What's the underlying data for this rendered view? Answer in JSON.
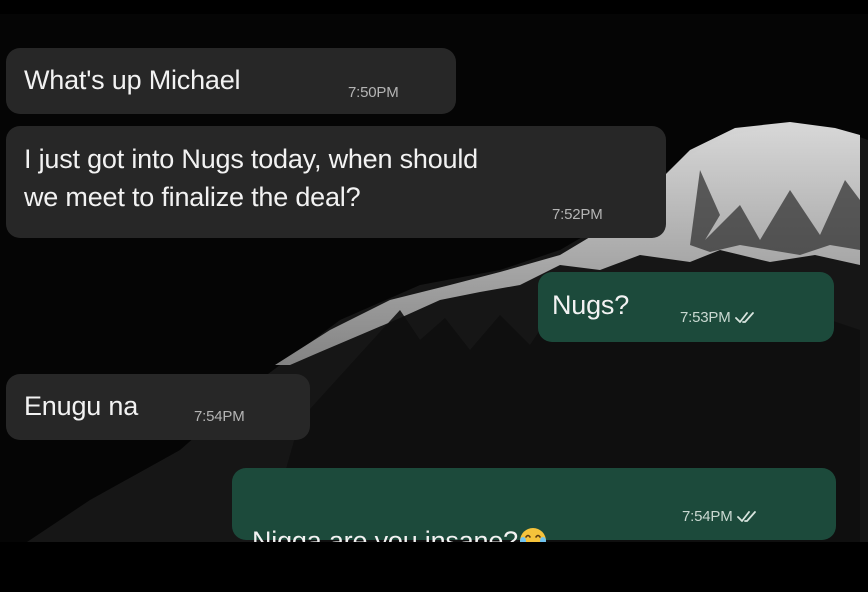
{
  "messages": [
    {
      "direction": "incoming",
      "text": "What's up Michael",
      "time": "7:50PM"
    },
    {
      "direction": "incoming",
      "text": "I just got into Nugs today, when should\nwe meet to finalize the deal?",
      "time": "7:52PM"
    },
    {
      "direction": "outgoing",
      "text": "Nugs?",
      "time": "7:53PM",
      "status": "read-double-check-icon"
    },
    {
      "direction": "incoming",
      "text": "Enugu na",
      "time": "7:54PM"
    },
    {
      "direction": "outgoing",
      "text": "Nigga are you insane?",
      "emoji": "laughing-tears-emoji",
      "time": "7:54PM",
      "status": "read-double-check-icon"
    }
  ],
  "colors": {
    "incoming_bubble": "#272727",
    "outgoing_bubble": "#1c4a3b",
    "text": "#f2f2f2",
    "timestamp": "#b4b4b4"
  }
}
